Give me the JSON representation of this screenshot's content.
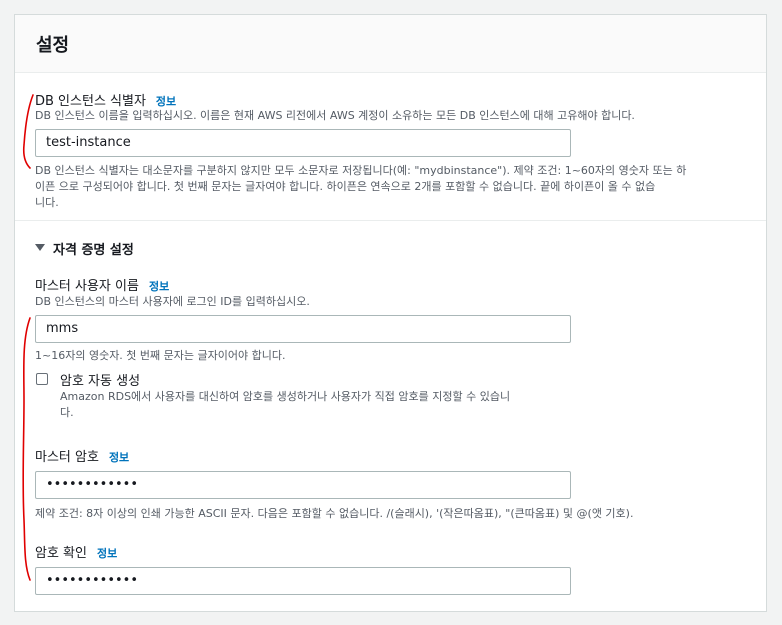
{
  "panel": {
    "title": "설정"
  },
  "db_identifier": {
    "label": "DB 인스턴스 식별자",
    "info": "정보",
    "description": "DB 인스턴스 이름을 입력하십시오. 이름은 현재 AWS 리전에서 AWS 계정이 소유하는 모든 DB 인스턴스에 대해 고유해야 합니다.",
    "value": "test-instance",
    "constraint_line1": "DB 인스턴스 식별자는 대소문자를 구분하지 않지만 모두 소문자로 저장됩니다(예: \"mydbinstance\"). 제약 조건: 1~60자의 영숫자 또는 하",
    "constraint_line2": "이픈 으로 구성되어야 합니다. 첫 번째 문자는 글자여야 합니다. 하이픈은 연속으로 2개를 포함할 수 없습니다. 끝에 하이픈이 올 수 없습",
    "constraint_line3": "니다."
  },
  "credentials": {
    "section_title": "자격 증명 설정",
    "master_username": {
      "label": "마스터 사용자 이름",
      "info": "정보",
      "description": "DB 인스턴스의 마스터 사용자에 로그인 ID를 입력하십시오.",
      "value": "mms",
      "constraint": "1~16자의 영숫자. 첫 번째 문자는 글자이어야 합니다."
    },
    "auto_generate": {
      "label": "암호 자동 생성",
      "checked": false,
      "description_line1": "Amazon RDS에서 사용자를 대신하여 암호를 생성하거나 사용자가 직접 암호를 지정할 수 있습니",
      "description_line2": "다."
    },
    "master_password": {
      "label": "마스터 암호",
      "info": "정보",
      "value": "••••••••••••",
      "constraint": "제약 조건: 8자 이상의 인쇄 가능한 ASCII 문자. 다음은 포함할 수 없습니다. /(슬래시), '(작은따옴표), \"(큰따옴표) 및 @(앳 기호)."
    },
    "confirm_password": {
      "label": "암호 확인",
      "info": "정보",
      "value": "••••••••••••"
    }
  },
  "colors": {
    "link": "#0073bb",
    "annotation": "#e00000"
  }
}
